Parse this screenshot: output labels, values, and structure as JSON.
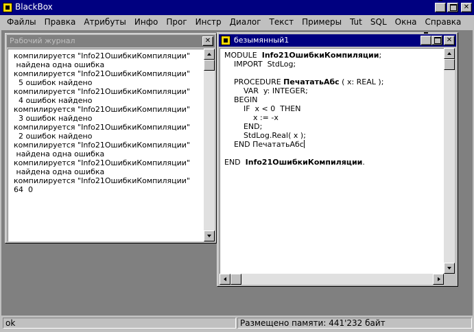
{
  "app": {
    "title": "BlackBox"
  },
  "menu": [
    "Файлы",
    "Правка",
    "Атрибуты",
    "Инфо",
    "Прог",
    "Инстр",
    "Диалог",
    "Текст",
    "Примеры",
    "Tut",
    "SQL",
    "Окна",
    "Справка"
  ],
  "log_window": {
    "title": "Рабочий журнал",
    "lines": [
      "компилируется \"Info21ОшибкиКомпиляции\"",
      " найдена одна ошибка",
      "компилируется \"Info21ОшибкиКомпиляции\"",
      "  5 ошибок найдено",
      "компилируется \"Info21ОшибкиКомпиляции\"",
      "  4 ошибок найдено",
      "компилируется \"Info21ОшибкиКомпиляции\"",
      "  3 ошибок найдено",
      "компилируется \"Info21ОшибкиКомпиляции\"",
      "  2 ошибок найдено",
      "компилируется \"Info21ОшибкиКомпиляции\"",
      " найдена одна ошибка",
      "компилируется \"Info21ОшибкиКомпиляции\"",
      " найдена одна ошибка",
      "компилируется \"Info21ОшибкиКомпиляции\"",
      "64  0"
    ]
  },
  "doc_window": {
    "title": "безымянный1",
    "code": {
      "l1_a": "MODULE  ",
      "l1_b": "Info21ОшибкиКомпиляции",
      "l1_c": ";",
      "l2": "    IMPORT  StdLog;",
      "l3": "",
      "l4_a": "    PROCEDURE ",
      "l4_b": "ПечататьАбс",
      "l4_c": " ( x: REAL );",
      "l5": "        VAR  y: INTEGER;",
      "l6": "    BEGIN",
      "l7": "        IF  x < 0  THEN",
      "l8": "            x := -x",
      "l9": "        END;",
      "l10": "        StdLog.Real( x );",
      "l11": "    END ПечататьАбс",
      "l12": "",
      "l13_a": "END  ",
      "l13_b": "Info21ОшибкиКомпиляции",
      "l13_c": "."
    }
  },
  "status": {
    "left": "ok",
    "memory": "Размещено памяти: 441'232 байт"
  }
}
